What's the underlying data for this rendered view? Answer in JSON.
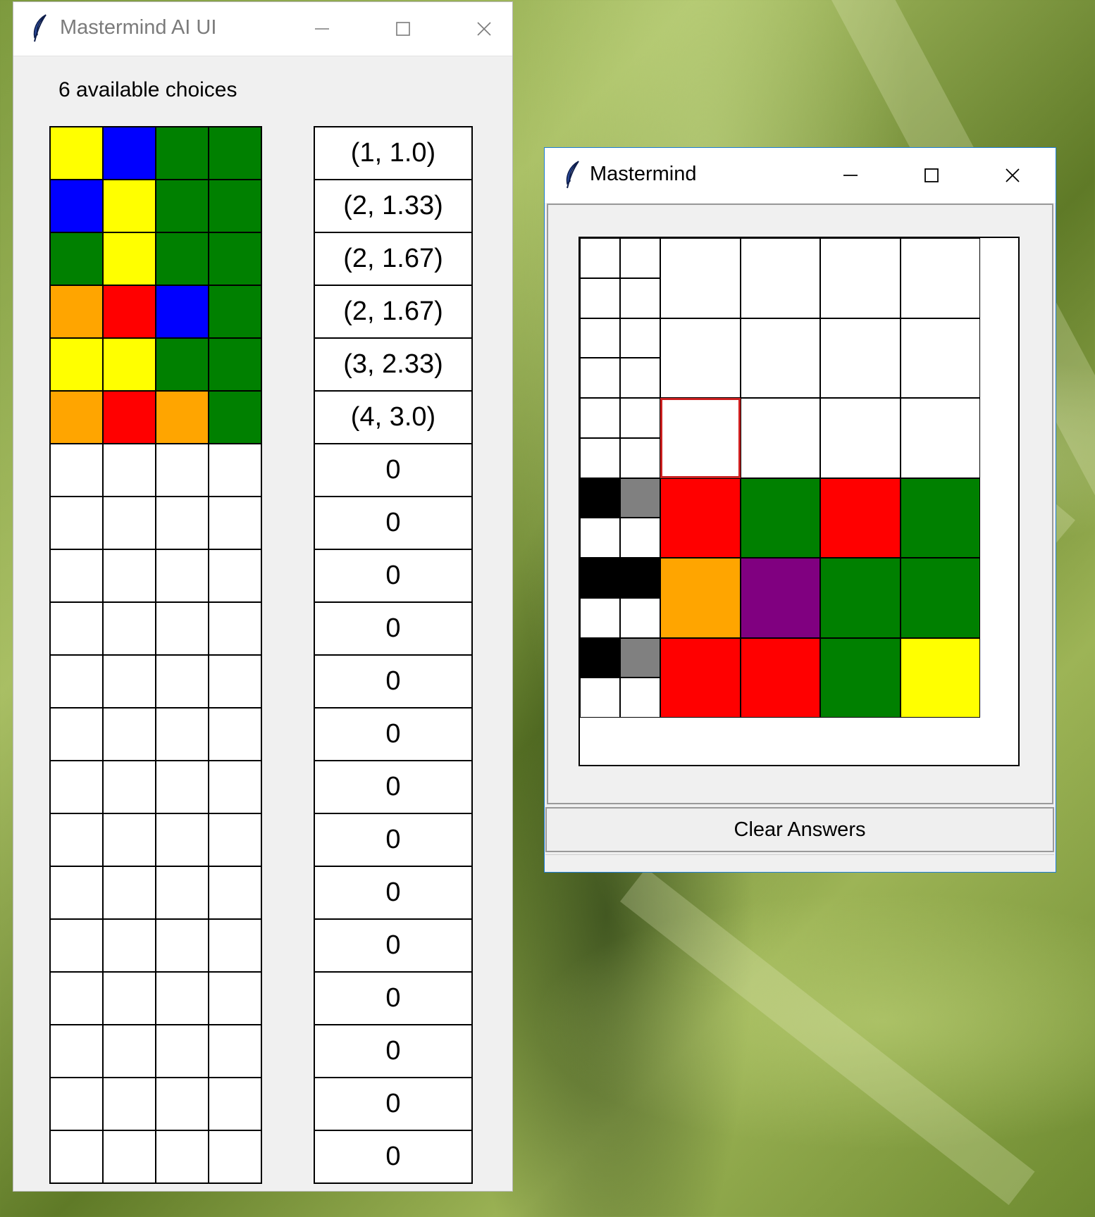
{
  "colors": {
    "yellow": "#ffff00",
    "blue": "#0000ff",
    "green": "#008000",
    "orange": "#ffa500",
    "red": "#ff0000",
    "purple": "#800080",
    "black": "#000000",
    "gray": "#808080",
    "white": "#ffffff"
  },
  "ai_window": {
    "title": "Mastermind AI UI",
    "icon": "feather-icon",
    "controls": [
      "minimize-icon",
      "maximize-icon",
      "close-icon"
    ],
    "choices_label": "6 available choices",
    "guess_rows": [
      [
        "yellow",
        "blue",
        "green",
        "green"
      ],
      [
        "blue",
        "yellow",
        "green",
        "green"
      ],
      [
        "green",
        "yellow",
        "green",
        "green"
      ],
      [
        "orange",
        "red",
        "blue",
        "green"
      ],
      [
        "yellow",
        "yellow",
        "green",
        "green"
      ],
      [
        "orange",
        "red",
        "orange",
        "green"
      ],
      [
        "white",
        "white",
        "white",
        "white"
      ],
      [
        "white",
        "white",
        "white",
        "white"
      ],
      [
        "white",
        "white",
        "white",
        "white"
      ],
      [
        "white",
        "white",
        "white",
        "white"
      ],
      [
        "white",
        "white",
        "white",
        "white"
      ],
      [
        "white",
        "white",
        "white",
        "white"
      ],
      [
        "white",
        "white",
        "white",
        "white"
      ],
      [
        "white",
        "white",
        "white",
        "white"
      ],
      [
        "white",
        "white",
        "white",
        "white"
      ],
      [
        "white",
        "white",
        "white",
        "white"
      ],
      [
        "white",
        "white",
        "white",
        "white"
      ],
      [
        "white",
        "white",
        "white",
        "white"
      ],
      [
        "white",
        "white",
        "white",
        "white"
      ],
      [
        "white",
        "white",
        "white",
        "white"
      ]
    ],
    "scores": [
      "(1, 1.0)",
      "(2, 1.33)",
      "(2, 1.67)",
      "(2, 1.67)",
      "(3, 2.33)",
      "(4, 3.0)",
      "0",
      "0",
      "0",
      "0",
      "0",
      "0",
      "0",
      "0",
      "0",
      "0",
      "0",
      "0",
      "0",
      "0"
    ]
  },
  "mm_window": {
    "title": "Mastermind",
    "icon": "feather-icon",
    "controls": [
      "minimize-icon",
      "maximize-icon",
      "close-icon"
    ],
    "selected_cell": {
      "row": 2,
      "col": 0
    },
    "rows": [
      {
        "pegs": [
          "white",
          "white",
          "white",
          "white"
        ],
        "cells": [
          "white",
          "white",
          "white",
          "white"
        ]
      },
      {
        "pegs": [
          "white",
          "white",
          "white",
          "white"
        ],
        "cells": [
          "white",
          "white",
          "white",
          "white"
        ]
      },
      {
        "pegs": [
          "white",
          "white",
          "white",
          "white"
        ],
        "cells": [
          "white",
          "white",
          "white",
          "white"
        ]
      },
      {
        "pegs": [
          "black",
          "gray",
          "white",
          "white"
        ],
        "cells": [
          "red",
          "green",
          "red",
          "green"
        ]
      },
      {
        "pegs": [
          "black",
          "black",
          "white",
          "white"
        ],
        "cells": [
          "orange",
          "purple",
          "green",
          "green"
        ]
      },
      {
        "pegs": [
          "black",
          "gray",
          "white",
          "white"
        ],
        "cells": [
          "red",
          "red",
          "green",
          "yellow"
        ]
      }
    ],
    "clear_button": "Clear Answers"
  }
}
